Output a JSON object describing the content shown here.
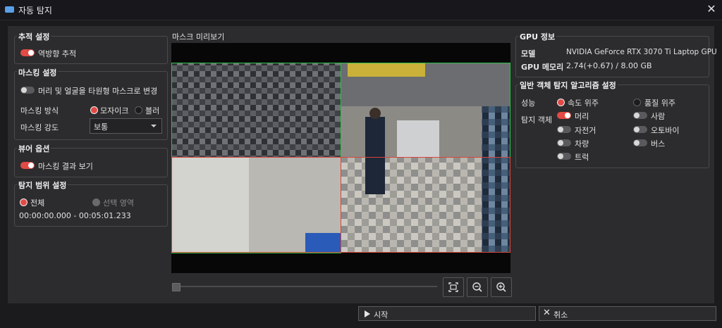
{
  "window": {
    "title": "자동 탐지",
    "close_glyph": "✕"
  },
  "tracking": {
    "title": "추적 설정",
    "reverse_tracking": {
      "label": "역방향 추적",
      "on": true
    }
  },
  "masking": {
    "title": "마스킹 설정",
    "ellipse_toggle": {
      "label": "머리 및 얼굴을 타원형 마스크로 변경",
      "on": false
    },
    "method": {
      "label": "마스킹 방식",
      "options": [
        "모자이크",
        "블러"
      ],
      "selected": "모자이크"
    },
    "strength": {
      "label": "마스킹 강도",
      "value": "보통"
    }
  },
  "view_options": {
    "title": "뷰어 옵션",
    "show_result": {
      "label": "마스킹 결과 보기",
      "on": true
    }
  },
  "detection_range": {
    "title": "탐지 범위 설정",
    "options": [
      "전체",
      "선택 영역"
    ],
    "selected": "전체",
    "time_range": "00:00:00.000 - 00:05:01.233"
  },
  "preview": {
    "title": "마스크 미리보기",
    "seek_position": 0,
    "buttons": [
      "fit-screen-icon",
      "zoom-out-icon",
      "zoom-in-icon"
    ],
    "colors": {
      "green_box": "#2fbf4a",
      "red_box": "#d8453a"
    }
  },
  "gpu": {
    "title": "GPU 정보",
    "model_label": "모델",
    "model_value": "NVIDIA GeForce RTX 3070 Ti Laptop GPU",
    "memory_label": "GPU 메모리",
    "memory_value": "2.74(+0.67) / 8.00 GB"
  },
  "algorithm": {
    "title": "일반 객체 탐지 알고리즘 설정",
    "performance_label": "성능",
    "performance_options": [
      "속도 위주",
      "품질 위주"
    ],
    "performance_selected": "속도 위주",
    "objects_label": "탐지 객체",
    "objects": [
      {
        "label": "머리",
        "on": true
      },
      {
        "label": "사람",
        "on": false
      },
      {
        "label": "자전거",
        "on": false
      },
      {
        "label": "오토바이",
        "on": false
      },
      {
        "label": "차량",
        "on": false
      },
      {
        "label": "버스",
        "on": false
      },
      {
        "label": "트럭",
        "on": false
      }
    ]
  },
  "footer": {
    "start_label": "시작",
    "start_icon": "play-icon",
    "cancel_label": "취소",
    "cancel_icon": "close-icon"
  },
  "theme": {
    "accent": "#e24a45",
    "background": "#2c2c2e",
    "titlebar": "#17171c"
  }
}
